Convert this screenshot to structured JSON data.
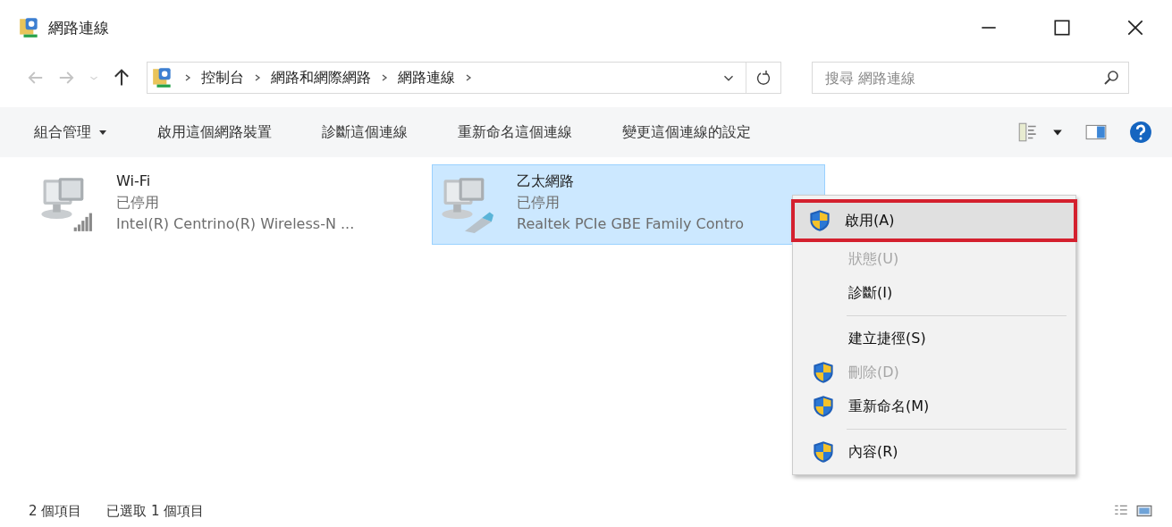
{
  "window": {
    "title": "網路連線"
  },
  "address": {
    "crumbs": [
      "控制台",
      "網路和網際網路",
      "網路連線"
    ]
  },
  "search": {
    "placeholder": "搜尋 網路連線"
  },
  "commands": [
    {
      "label": "組合管理",
      "dropdown": true
    },
    {
      "label": "啟用這個網路裝置",
      "dropdown": false
    },
    {
      "label": "診斷這個連線",
      "dropdown": false
    },
    {
      "label": "重新命名這個連線",
      "dropdown": false
    },
    {
      "label": "變更這個連線的設定",
      "dropdown": false
    }
  ],
  "connections": [
    {
      "name": "Wi-Fi",
      "status": "已停用",
      "device": "Intel(R) Centrino(R) Wireless-N ...",
      "kind": "wireless",
      "selected": false
    },
    {
      "name": "乙太網路",
      "status": "已停用",
      "device": "Realtek PCIe GBE Family Contro",
      "kind": "wired",
      "selected": true
    }
  ],
  "context_menu": [
    {
      "label": "啟用(A)",
      "shield": true,
      "disabled": false,
      "selected": true
    },
    {
      "label": "狀態(U)",
      "shield": false,
      "disabled": true,
      "selected": false
    },
    {
      "label": "診斷(I)",
      "shield": false,
      "disabled": false,
      "selected": false
    },
    {
      "kind": "separator"
    },
    {
      "label": "建立捷徑(S)",
      "shield": false,
      "disabled": false,
      "selected": false
    },
    {
      "label": "刪除(D)",
      "shield": true,
      "disabled": true,
      "selected": false
    },
    {
      "label": "重新命名(M)",
      "shield": true,
      "disabled": false,
      "selected": false
    },
    {
      "kind": "separator"
    },
    {
      "label": "內容(R)",
      "shield": true,
      "disabled": false,
      "selected": false
    }
  ],
  "status_bar": {
    "count": "2 個項目",
    "selection": "已選取 1 個項目"
  }
}
